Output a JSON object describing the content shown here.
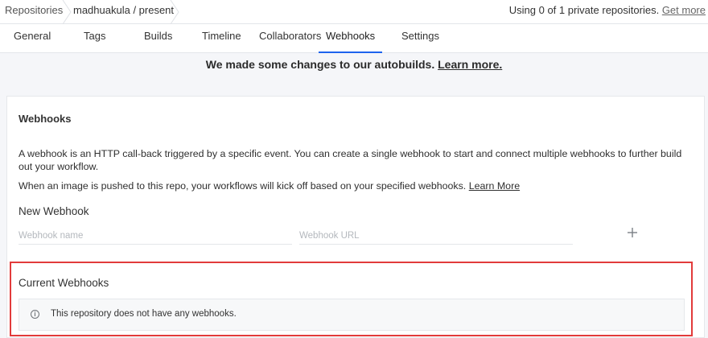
{
  "breadcrumb": {
    "root": "Repositories",
    "repo": "madhuakula / present"
  },
  "usage": {
    "text": "Using 0 of 1 private repositories.",
    "link": "Get more"
  },
  "tabs": [
    {
      "label": "General"
    },
    {
      "label": "Tags"
    },
    {
      "label": "Builds"
    },
    {
      "label": "Timeline"
    },
    {
      "label": "Collaborators"
    },
    {
      "label": "Webhooks",
      "active": true
    },
    {
      "label": "Settings"
    }
  ],
  "banner": {
    "text": "We made some changes to our autobuilds.",
    "link": "Learn more."
  },
  "webhooks": {
    "title": "Webhooks",
    "description_1": "A webhook is an HTTP call-back triggered by a specific event. You can create a single webhook to start and connect multiple webhooks to further build out your workflow.",
    "description_2": "When an image is pushed to this repo, your workflows will kick off based on your specified webhooks.",
    "learn_more": "Learn More",
    "new_title": "New Webhook",
    "name_placeholder": "Webhook name",
    "url_placeholder": "Webhook URL",
    "add_icon": "plus-icon",
    "current_title": "Current Webhooks",
    "empty_text": "This repository does not have any webhooks.",
    "info_icon": "info-icon"
  },
  "colors": {
    "accent": "#1d63ed",
    "highlight": "#e23b3b"
  }
}
